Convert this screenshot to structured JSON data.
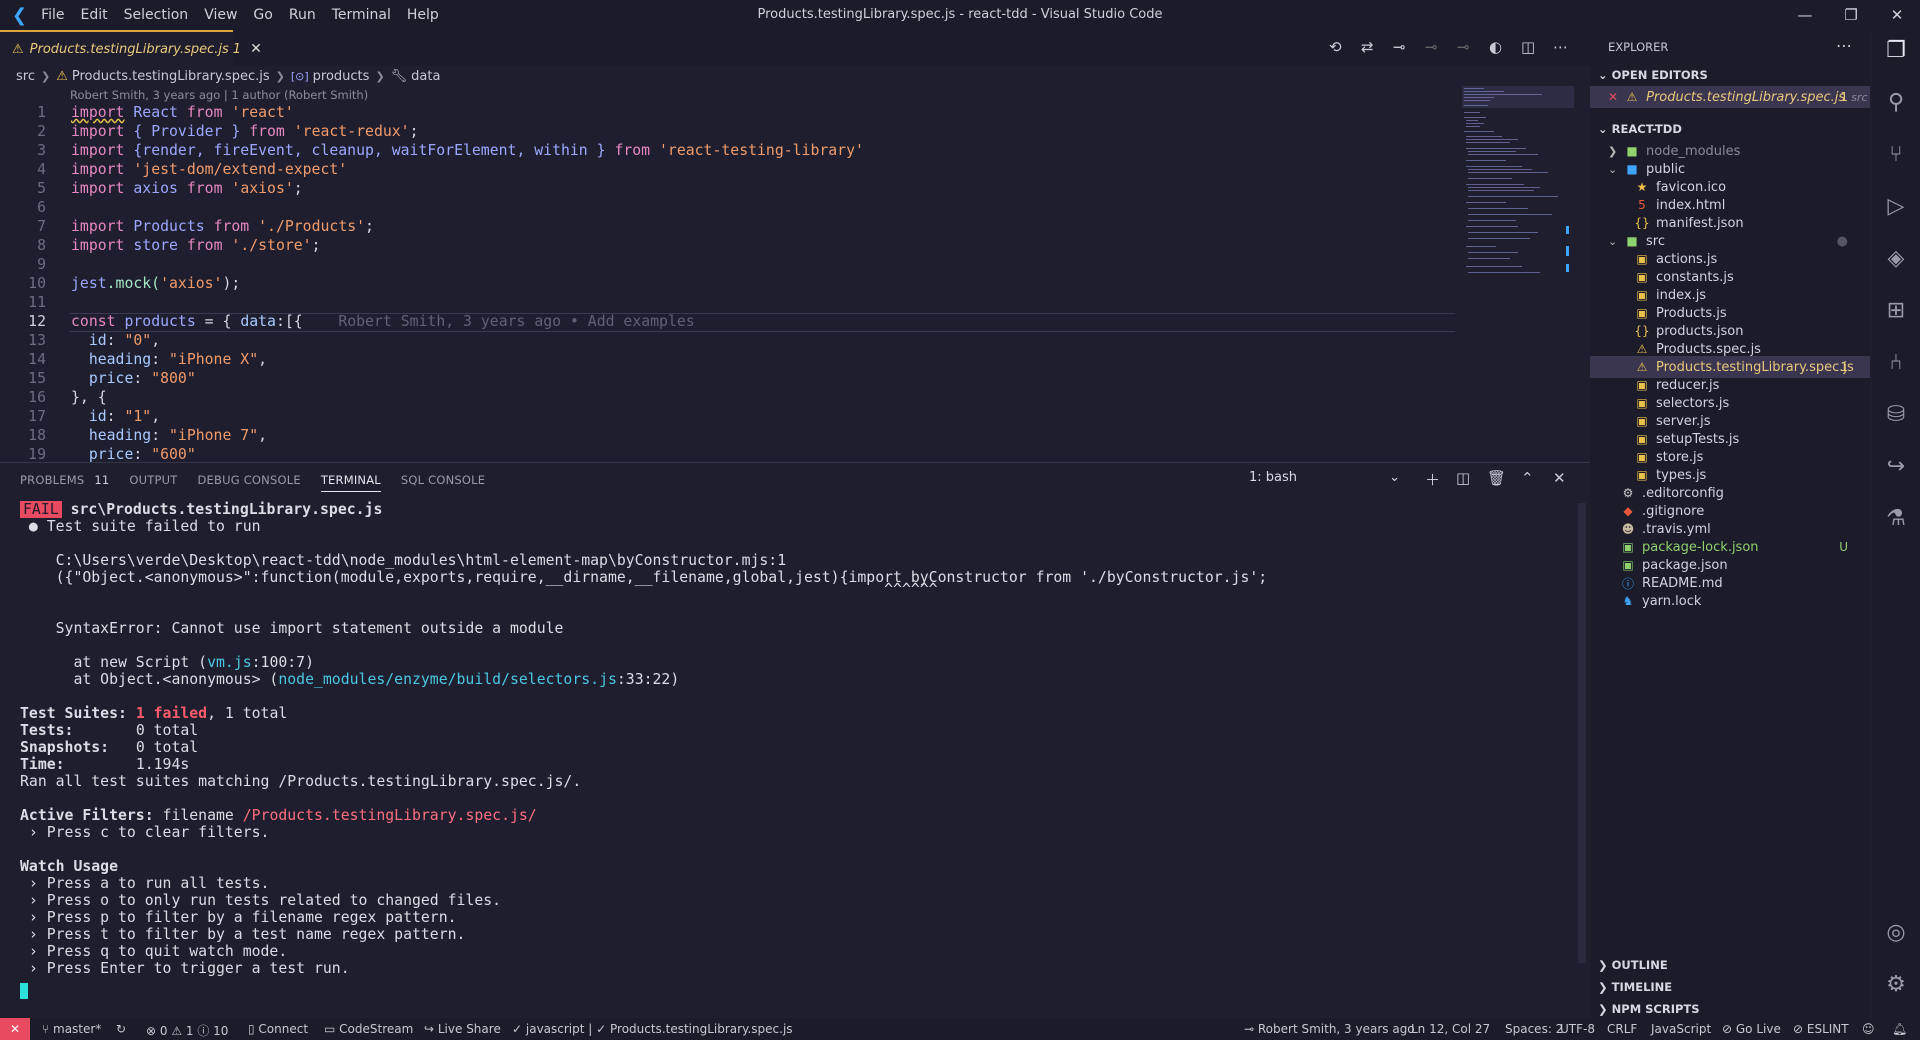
{
  "window": {
    "title": "Products.testingLibrary.spec.js - react-tdd - Visual Studio Code",
    "menu": [
      "File",
      "Edit",
      "Selection",
      "View",
      "Go",
      "Run",
      "Terminal",
      "Help"
    ]
  },
  "tab": {
    "file": "Products.testingLibrary.spec.js",
    "problems": "1"
  },
  "breadcrumb": {
    "folder": "src",
    "file": "Products.testingLibrary.spec.js",
    "symbol": "products",
    "sub": "data"
  },
  "blame": {
    "header": "Robert Smith, 3 years ago | 1 author (Robert Smith)",
    "inline": "Robert Smith, 3 years ago • Add examples"
  },
  "code": {
    "line_numbers": [
      "1",
      "2",
      "3",
      "4",
      "5",
      "6",
      "7",
      "8",
      "9",
      "10",
      "11",
      "12",
      "13",
      "14",
      "15",
      "16",
      "17",
      "18",
      "19"
    ],
    "l1": [
      "import",
      "React",
      "from",
      "'react'"
    ],
    "l2": [
      "import",
      "{ Provider }",
      "from",
      "'react-redux'",
      ";"
    ],
    "l3": [
      "import",
      "{render, fireEvent, cleanup, waitForElement, within }",
      "from",
      "'react-testing-library'"
    ],
    "l4": [
      "import",
      "'jest-dom/extend-expect'"
    ],
    "l5": [
      "import",
      "axios",
      "from",
      "'axios'",
      ";"
    ],
    "l7": [
      "import",
      "Products",
      "from",
      "'./Products'",
      ";"
    ],
    "l8": [
      "import",
      "store",
      "from",
      "'./store'",
      ";"
    ],
    "l10": [
      "jest",
      ".mock(",
      "'axios'",
      ");"
    ],
    "l12": [
      "const",
      "products",
      "= {",
      "data",
      ":[{"
    ],
    "l13": [
      "  id",
      ": ",
      "\"0\"",
      ","
    ],
    "l14": [
      "  heading",
      ": ",
      "\"iPhone X\"",
      ","
    ],
    "l15": [
      "  price",
      ": ",
      "\"800\""
    ],
    "l16": [
      "}, {"
    ],
    "l17": [
      "  id",
      ": ",
      "\"1\"",
      ","
    ],
    "l18": [
      "  heading",
      ": ",
      "\"iPhone 7\"",
      ","
    ],
    "l19": [
      "  price",
      ": ",
      "\"600\""
    ]
  },
  "panel": {
    "tabs": [
      "PROBLEMS",
      "OUTPUT",
      "DEBUG CONSOLE",
      "TERMINAL",
      "SQL CONSOLE"
    ],
    "problems_count": "11",
    "terminal_select": "1: bash"
  },
  "terminal": {
    "fail_badge": "FAIL",
    "fail_file": "src\\Products.testingLibrary.spec.js",
    "suite_failed": " ● Test suite failed to run",
    "path": "    C:\\Users\\verde\\Desktop\\react-tdd\\node_modules\\html-element-map\\byConstructor.mjs:1",
    "code": "    ({\"Object.<anonymous>\":function(module,exports,require,__dirname,__filename,global,jest){import byConstructor from './byConstructor.js';",
    "carets": "                                                                                                 ^^^^^^",
    "syntax": "    SyntaxError: Cannot use import statement outside a module",
    "at1_pre": "      at new Script (",
    "at1_link": "vm.js",
    "at1_post": ":100:7)",
    "at2_pre": "      at Object.<anonymous> (",
    "at2_link": "node_modules/enzyme/build/selectors.js",
    "at2_post": ":33:22)",
    "suites_label": "Test Suites: ",
    "suites_failed": "1 failed",
    "suites_rest": ", 1 total",
    "tests_label": "Tests:       ",
    "tests_val": "0 total",
    "snap_label": "Snapshots:   ",
    "snap_val": "0 total",
    "time_label": "Time:        ",
    "time_val": "1.194s",
    "ran": "Ran all test suites matching /Products.testingLibrary.spec.js/.",
    "filters_label": "Active Filters: ",
    "filters_pre": "filename ",
    "filters_val": "/Products.testingLibrary.spec.js/",
    "press_c": " › Press c to clear filters.",
    "watch": "Watch Usage",
    "w1": " › Press a to run all tests.",
    "w2": " › Press o to only run tests related to changed files.",
    "w3": " › Press p to filter by a filename regex pattern.",
    "w4": " › Press t to filter by a test name regex pattern.",
    "w5": " › Press q to quit watch mode.",
    "w6": " › Press Enter to trigger a test run."
  },
  "explorer": {
    "title": "EXPLORER",
    "open_editors": "OPEN EDITORS",
    "open_file": "Products.testingLibrary.spec.js",
    "open_dir": "src",
    "open_count": "1",
    "project": "REACT-TDD",
    "items": [
      {
        "name": "node_modules",
        "kind": "folder"
      },
      {
        "name": "public",
        "kind": "folder"
      },
      {
        "name": "favicon.ico",
        "kind": "file"
      },
      {
        "name": "index.html",
        "kind": "file"
      },
      {
        "name": "manifest.json",
        "kind": "file"
      },
      {
        "name": "src",
        "kind": "folder"
      },
      {
        "name": "actions.js",
        "kind": "file"
      },
      {
        "name": "constants.js",
        "kind": "file"
      },
      {
        "name": "index.js",
        "kind": "file"
      },
      {
        "name": "Products.js",
        "kind": "file"
      },
      {
        "name": "products.json",
        "kind": "file"
      },
      {
        "name": "Products.spec.js",
        "kind": "file"
      },
      {
        "name": "Products.testingLibrary.spec.js",
        "kind": "file",
        "tag": "1"
      },
      {
        "name": "reducer.js",
        "kind": "file"
      },
      {
        "name": "selectors.js",
        "kind": "file"
      },
      {
        "name": "server.js",
        "kind": "file"
      },
      {
        "name": "setupTests.js",
        "kind": "file"
      },
      {
        "name": "store.js",
        "kind": "file"
      },
      {
        "name": "types.js",
        "kind": "file"
      },
      {
        "name": ".editorconfig",
        "kind": "file"
      },
      {
        "name": ".gitignore",
        "kind": "file"
      },
      {
        "name": ".travis.yml",
        "kind": "file"
      },
      {
        "name": "package-lock.json",
        "kind": "file",
        "tag": "U"
      },
      {
        "name": "package.json",
        "kind": "file"
      },
      {
        "name": "README.md",
        "kind": "file"
      },
      {
        "name": "yarn.lock",
        "kind": "file"
      }
    ],
    "outline": "OUTLINE",
    "timeline": "TIMELINE",
    "npm": "NPM SCRIPTS"
  },
  "status": {
    "branch": "master*",
    "problems": "⊗ 0 ⚠ 1 ⓘ 10",
    "connect": "Connect",
    "codestream": "CodeStream",
    "liveshare": "Live Share",
    "lang_check": "javascript | ✓ Products.testingLibrary.spec.js",
    "blame": "Robert Smith, 3 years ago",
    "pos": "Ln 12, Col 27",
    "spaces": "Spaces: 2",
    "enc": "UTF-8",
    "eol": "CRLF",
    "lang": "JavaScript",
    "golive": "Go Live",
    "eslint": "ESLINT"
  }
}
